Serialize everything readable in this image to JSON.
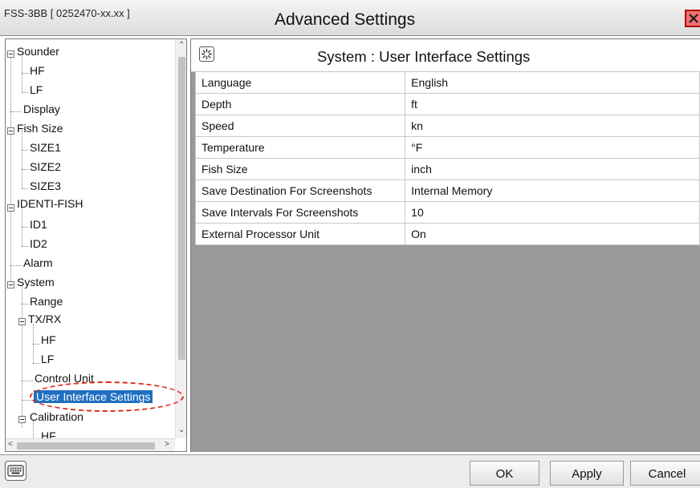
{
  "title_bar": {
    "device_id": "FSS-3BB [ 0252470-xx.xx ]",
    "title": "Advanced Settings"
  },
  "tree": {
    "items": [
      {
        "label": "Sounder",
        "level": 0,
        "expanded": true
      },
      {
        "label": "HF",
        "level": 1
      },
      {
        "label": "LF",
        "level": 1
      },
      {
        "label": "Display",
        "level": 0
      },
      {
        "label": "Fish Size",
        "level": 0,
        "expanded": true
      },
      {
        "label": "SIZE1",
        "level": 1
      },
      {
        "label": "SIZE2",
        "level": 1
      },
      {
        "label": "SIZE3",
        "level": 1
      },
      {
        "label": "IDENTI-FISH",
        "level": 0,
        "expanded": true
      },
      {
        "label": "ID1",
        "level": 1
      },
      {
        "label": "ID2",
        "level": 1
      },
      {
        "label": "Alarm",
        "level": 0
      },
      {
        "label": "System",
        "level": 0,
        "expanded": true
      },
      {
        "label": "Range",
        "level": 1
      },
      {
        "label": "TX/RX",
        "level": 1,
        "expanded": true
      },
      {
        "label": "HF",
        "level": 2
      },
      {
        "label": "LF",
        "level": 2
      },
      {
        "label": "Control Unit",
        "level": 1
      },
      {
        "label": "User Interface Settings",
        "level": 1,
        "selected": true
      },
      {
        "label": "Calibration",
        "level": 1,
        "expanded": true
      },
      {
        "label": "HF",
        "level": 2
      }
    ]
  },
  "panel": {
    "title": "System : User Interface Settings",
    "settings": [
      {
        "label": "Language",
        "value": "English"
      },
      {
        "label": "Depth",
        "value": "ft"
      },
      {
        "label": "Speed",
        "value": "kn"
      },
      {
        "label": "Temperature",
        "value": "°F"
      },
      {
        "label": "Fish Size",
        "value": "inch"
      },
      {
        "label": "Save Destination For Screenshots",
        "value": "Internal Memory"
      },
      {
        "label": "Save Intervals For Screenshots",
        "value": "10"
      },
      {
        "label": "External Processor Unit",
        "value": "On"
      }
    ]
  },
  "buttons": {
    "ok": "OK",
    "apply": "Apply",
    "cancel": "Cancel"
  },
  "icons": {
    "close": "close-icon",
    "panel": "settings-sparkle-icon",
    "keyboard": "keyboard-icon"
  },
  "colors": {
    "selection": "#1f6fc0",
    "highlight_ring": "#e0281e",
    "panel_background": "#999999"
  }
}
